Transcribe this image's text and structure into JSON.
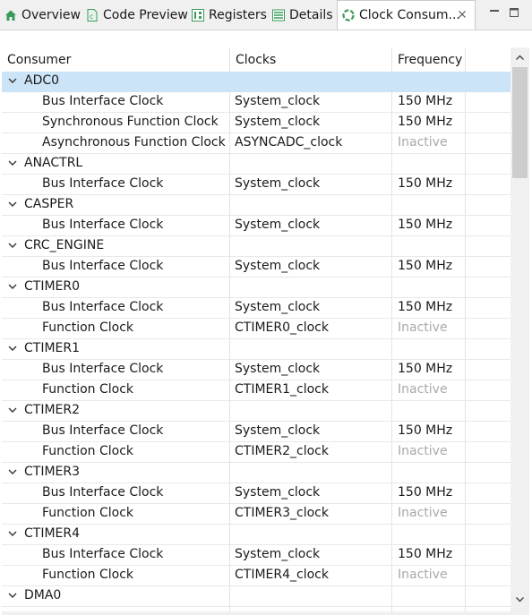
{
  "tabs": [
    {
      "label": "Overview",
      "icon": "home-icon"
    },
    {
      "label": "Code Preview",
      "icon": "code-file-icon"
    },
    {
      "label": "Registers",
      "icon": "registers-icon"
    },
    {
      "label": "Details",
      "icon": "details-list-icon"
    },
    {
      "label": "Clock Consum...",
      "icon": "clock-consumers-icon",
      "active": true
    }
  ],
  "columns": {
    "consumer": "Consumer",
    "clocks": "Clocks",
    "frequency": "Frequency"
  },
  "groups": [
    {
      "name": "ADC0",
      "selected": true,
      "children": [
        {
          "consumer": "Bus Interface Clock",
          "clock": "System_clock",
          "frequency": "150 MHz",
          "inactive": false
        },
        {
          "consumer": "Synchronous Function Clock",
          "clock": "System_clock",
          "frequency": "150 MHz",
          "inactive": false
        },
        {
          "consumer": "Asynchronous Function Clock",
          "clock": "ASYNCADC_clock",
          "frequency": "Inactive",
          "inactive": true
        }
      ]
    },
    {
      "name": "ANACTRL",
      "children": [
        {
          "consumer": "Bus Interface Clock",
          "clock": "System_clock",
          "frequency": "150 MHz",
          "inactive": false
        }
      ]
    },
    {
      "name": "CASPER",
      "children": [
        {
          "consumer": "Bus Interface Clock",
          "clock": "System_clock",
          "frequency": "150 MHz",
          "inactive": false
        }
      ]
    },
    {
      "name": "CRC_ENGINE",
      "children": [
        {
          "consumer": "Bus Interface Clock",
          "clock": "System_clock",
          "frequency": "150 MHz",
          "inactive": false
        }
      ]
    },
    {
      "name": "CTIMER0",
      "children": [
        {
          "consumer": "Bus Interface Clock",
          "clock": "System_clock",
          "frequency": "150 MHz",
          "inactive": false
        },
        {
          "consumer": "Function Clock",
          "clock": "CTIMER0_clock",
          "frequency": "Inactive",
          "inactive": true
        }
      ]
    },
    {
      "name": "CTIMER1",
      "children": [
        {
          "consumer": "Bus Interface Clock",
          "clock": "System_clock",
          "frequency": "150 MHz",
          "inactive": false
        },
        {
          "consumer": "Function Clock",
          "clock": "CTIMER1_clock",
          "frequency": "Inactive",
          "inactive": true
        }
      ]
    },
    {
      "name": "CTIMER2",
      "children": [
        {
          "consumer": "Bus Interface Clock",
          "clock": "System_clock",
          "frequency": "150 MHz",
          "inactive": false
        },
        {
          "consumer": "Function Clock",
          "clock": "CTIMER2_clock",
          "frequency": "Inactive",
          "inactive": true
        }
      ]
    },
    {
      "name": "CTIMER3",
      "children": [
        {
          "consumer": "Bus Interface Clock",
          "clock": "System_clock",
          "frequency": "150 MHz",
          "inactive": false
        },
        {
          "consumer": "Function Clock",
          "clock": "CTIMER3_clock",
          "frequency": "Inactive",
          "inactive": true
        }
      ]
    },
    {
      "name": "CTIMER4",
      "children": [
        {
          "consumer": "Bus Interface Clock",
          "clock": "System_clock",
          "frequency": "150 MHz",
          "inactive": false
        },
        {
          "consumer": "Function Clock",
          "clock": "CTIMER4_clock",
          "frequency": "Inactive",
          "inactive": true
        }
      ]
    },
    {
      "name": "DMA0",
      "children": []
    }
  ],
  "colors": {
    "selection": "#cce4f7",
    "inactive_text": "#a9a9a9",
    "icon_green": "#3a9a5b"
  }
}
